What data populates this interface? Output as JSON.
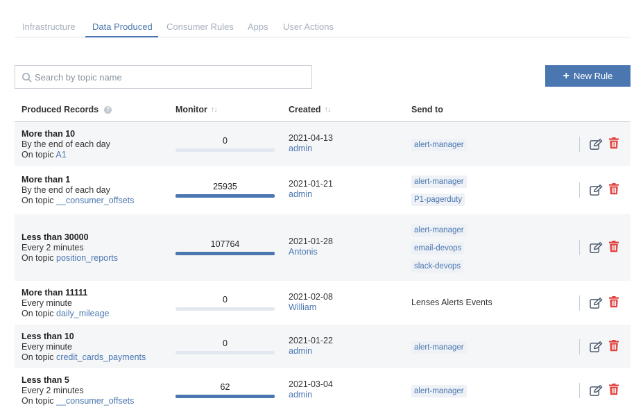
{
  "tabs": [
    {
      "label": "Infrastructure",
      "active": false
    },
    {
      "label": "Data Produced",
      "active": true
    },
    {
      "label": "Consumer Rules",
      "active": false
    },
    {
      "label": "Apps",
      "active": false
    },
    {
      "label": "User Actions",
      "active": false
    }
  ],
  "search": {
    "placeholder": "Search by topic name",
    "value": ""
  },
  "new_rule_label": "New Rule",
  "columns": {
    "produced_records": "Produced Records",
    "monitor": "Monitor",
    "created": "Created",
    "send_to": "Send to"
  },
  "rows": [
    {
      "title": "More than 10",
      "period": "By the end of each day",
      "topic_prefix": "On topic",
      "topic": "A1",
      "monitor_value": "0",
      "monitor_fill": 0,
      "date": "2021-04-13",
      "user": "admin",
      "send_to": [
        "alert-manager"
      ],
      "send_to_plain": ""
    },
    {
      "title": "More than 1",
      "period": "By the end of each day",
      "topic_prefix": "On topic",
      "topic": "__consumer_offsets",
      "monitor_value": "25935",
      "monitor_fill": 1,
      "date": "2021-01-21",
      "user": "admin",
      "send_to": [
        "alert-manager",
        "P1-pagerduty"
      ],
      "send_to_plain": ""
    },
    {
      "title": "Less than 30000",
      "period": "Every 2 minutes",
      "topic_prefix": "On topic",
      "topic": "position_reports",
      "monitor_value": "107764",
      "monitor_fill": 1,
      "date": "2021-01-28",
      "user": "Antonis",
      "send_to": [
        "alert-manager",
        "email-devops",
        "slack-devops"
      ],
      "send_to_plain": ""
    },
    {
      "title": "More than 11111",
      "period": "Every minute",
      "topic_prefix": "On topic",
      "topic": "daily_mileage",
      "monitor_value": "0",
      "monitor_fill": 0,
      "date": "2021-02-08",
      "user": "William",
      "send_to": [],
      "send_to_plain": "Lenses Alerts Events"
    },
    {
      "title": "Less than 10",
      "period": "Every minute",
      "topic_prefix": "On topic",
      "topic": "credit_cards_payments",
      "monitor_value": "0",
      "monitor_fill": 0,
      "date": "2021-01-22",
      "user": "admin",
      "send_to": [
        "alert-manager"
      ],
      "send_to_plain": ""
    },
    {
      "title": "Less than 5",
      "period": "Every 2 minutes",
      "topic_prefix": "On topic",
      "topic": "__consumer_offsets",
      "monitor_value": "62",
      "monitor_fill": 1,
      "date": "2021-03-04",
      "user": "admin",
      "send_to": [
        "alert-manager"
      ],
      "send_to_plain": ""
    }
  ],
  "colors": {
    "accent": "#4a77b0",
    "delete": "#e0413e",
    "tab_inactive": "#a6b0bc"
  },
  "icons": {
    "search": "search-icon",
    "add": "plus-icon",
    "edit": "edit-icon",
    "delete": "trash-icon",
    "help": "help-icon",
    "sort": "sort-icon"
  }
}
